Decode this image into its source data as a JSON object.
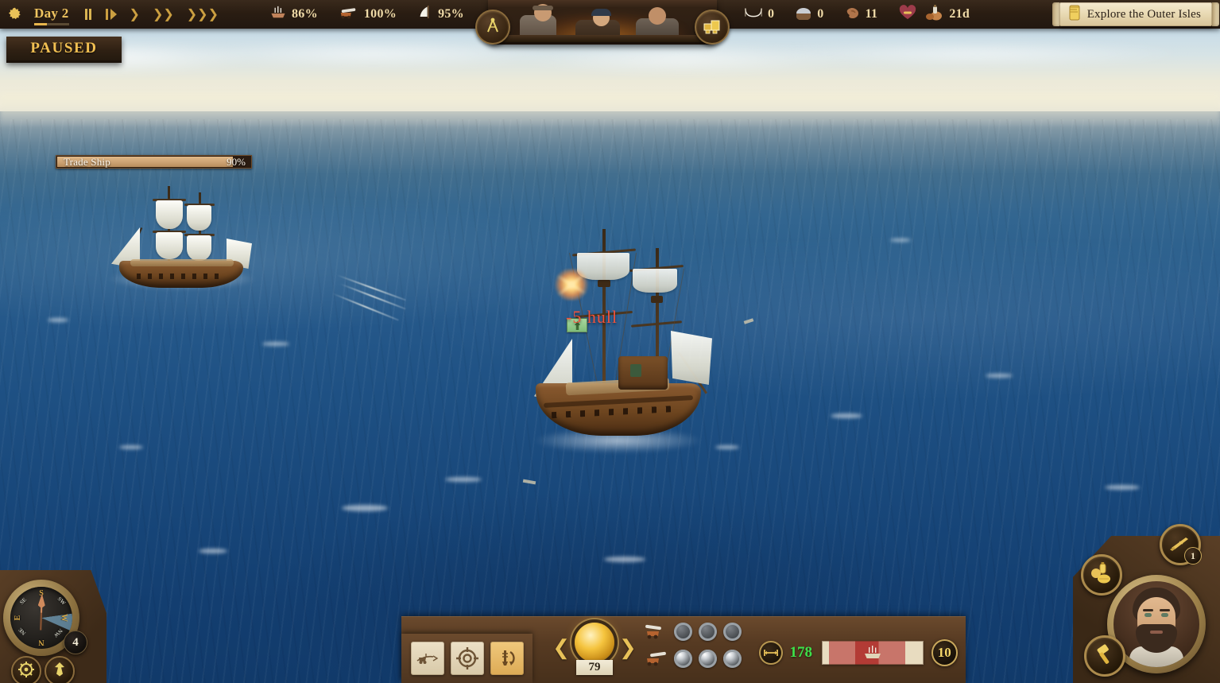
{
  "topbar": {
    "settings_icon": "gear-icon",
    "day_label": "Day 2",
    "speed_controls": [
      {
        "name": "pause",
        "glyph": "❚❚",
        "active": true
      },
      {
        "name": "play-slow",
        "glyph": "❙▶",
        "active": false
      },
      {
        "name": "speed-1x",
        "glyph": "❯",
        "active": false
      },
      {
        "name": "speed-2x",
        "glyph": "❯❯",
        "active": false
      },
      {
        "name": "speed-3x",
        "glyph": "❯❯❯",
        "active": false
      }
    ],
    "ship_stats": [
      {
        "icon": "hull-ship-icon",
        "value": "86%"
      },
      {
        "icon": "cannon-icon",
        "value": "100%"
      },
      {
        "icon": "sail-icon",
        "value": "95%"
      }
    ],
    "crew_stats": [
      {
        "icon": "hammock-icon",
        "value": "0"
      },
      {
        "icon": "helmet-icon",
        "value": "0"
      },
      {
        "icon": "muscle-icon",
        "value": "11"
      },
      {
        "icon": "morale-heart-icon",
        "value": ""
      },
      {
        "icon": "provisions-icon",
        "value": "21d"
      }
    ],
    "quest_banner": {
      "icon": "scroll-icon",
      "text": "Explore the Outer Isles"
    },
    "crew_panel": {
      "left_button_icon": "navigation-divider-icon",
      "right_button_icon": "cargo-crates-icon"
    }
  },
  "status": {
    "paused_label": "PAUSED"
  },
  "world": {
    "enemy_ship": {
      "name": "Trade Ship",
      "health_percent": "90%",
      "health_value": 90
    },
    "damage_popup": {
      "text": "-5 hull"
    }
  },
  "compass": {
    "wind_strength": "4",
    "cardinals": [
      "N",
      "E",
      "S",
      "W"
    ],
    "intercardinals": [
      "NE",
      "SE",
      "SW",
      "NW"
    ],
    "buttons": [
      {
        "name": "helm-wheel-button",
        "icon": "ships-wheel-icon"
      },
      {
        "name": "anchor-button",
        "icon": "anchor-icon"
      }
    ]
  },
  "action_bar": {
    "abilities": [
      {
        "name": "boarding-grapple",
        "icon": "grapple-icon",
        "active": false
      },
      {
        "name": "target-reticle",
        "icon": "crosshair-icon",
        "active": false
      },
      {
        "name": "ship-turn",
        "icon": "turn-ship-icon",
        "active": true
      }
    ],
    "speed_dial": {
      "value": "79",
      "prev_icon": "chevron-left-icon",
      "next_icon": "chevron-right-icon",
      "orb_icon": "speed-orb-icon"
    },
    "cannon_rows": [
      {
        "side_icon": "cannon-left-icon",
        "shots": [
          false,
          false,
          false
        ]
      },
      {
        "side_icon": "cannon-right-icon",
        "shots": [
          true,
          true,
          true
        ]
      }
    ],
    "range": {
      "distance_icon": "distance-icon",
      "distance_value": "178",
      "ship_marker_icon": "ship-marker-icon",
      "ammo_value": "10"
    }
  },
  "captain": {
    "portrait_name": "captain-portrait",
    "abilities": [
      {
        "name": "musket-ability",
        "icon": "musket-icon",
        "badge": "1"
      },
      {
        "name": "provisions-ability",
        "icon": "food-rations-icon",
        "badge": ""
      },
      {
        "name": "repair-ability",
        "icon": "hammer-icon",
        "badge": ""
      }
    ]
  },
  "colors": {
    "gold": "#e8c158",
    "parchment": "#ece0c6",
    "damage_red": "#f0523c",
    "distance_green": "#3ee04a",
    "wood_dark": "#2a1d12",
    "sea_deep": "#113a6a"
  }
}
